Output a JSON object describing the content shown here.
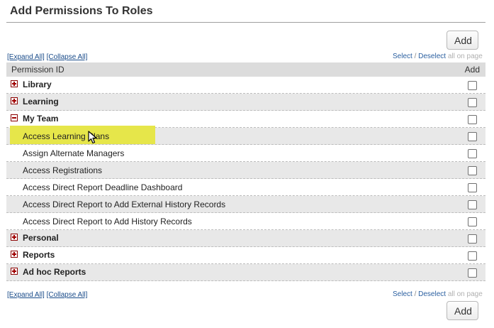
{
  "page": {
    "title": "Add Permissions To Roles"
  },
  "buttons": {
    "add_top": "Add",
    "add_bottom": "Add"
  },
  "links": {
    "expand_all": "[Expand All]",
    "collapse_all": "[Collapse All]",
    "select": "Select",
    "separator": "/",
    "deselect": "Deselect",
    "all_on_page": "all on page"
  },
  "table": {
    "col_permission": "Permission ID",
    "col_add": "Add",
    "rows": [
      {
        "type": "group",
        "label": "Library",
        "expanded": false
      },
      {
        "type": "group",
        "label": "Learning",
        "expanded": false
      },
      {
        "type": "group",
        "label": "My Team",
        "expanded": true
      },
      {
        "type": "item",
        "label": "Access Learning Plans",
        "highlighted": true
      },
      {
        "type": "item",
        "label": "Assign Alternate Managers"
      },
      {
        "type": "item",
        "label": "Access Registrations"
      },
      {
        "type": "item",
        "label": "Access Direct Report Deadline Dashboard"
      },
      {
        "type": "item",
        "label": "Access Direct Report to Add External History Records"
      },
      {
        "type": "item",
        "label": "Access Direct Report to Add History Records"
      },
      {
        "type": "group",
        "label": "Personal",
        "expanded": false
      },
      {
        "type": "group",
        "label": "Reports",
        "expanded": false
      },
      {
        "type": "group",
        "label": "Ad hoc Reports",
        "expanded": false
      }
    ]
  },
  "colors": {
    "highlight": "#e6e64a",
    "toggle": "#a00000",
    "link": "#1a4c8a"
  }
}
